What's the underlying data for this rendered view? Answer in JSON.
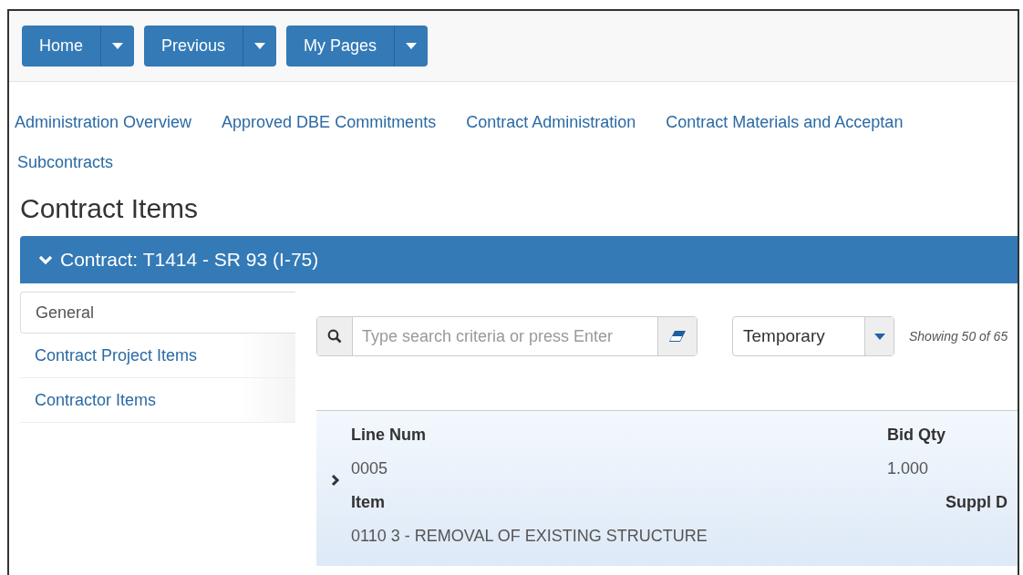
{
  "toolbar": {
    "buttons": [
      {
        "label": "Home"
      },
      {
        "label": "Previous"
      },
      {
        "label": "My Pages"
      }
    ]
  },
  "nav_links": [
    {
      "label": "Administration Overview"
    },
    {
      "label": "Approved DBE Commitments"
    },
    {
      "label": "Contract Administration"
    },
    {
      "label": "Contract Materials and Acceptan"
    },
    {
      "label": "Subcontracts"
    }
  ],
  "page_title": "Contract Items",
  "contract_panel": {
    "title": "Contract: T1414 - SR 93 (I-75)",
    "expanded": true
  },
  "side_tabs": [
    {
      "label": "General",
      "selected": true
    },
    {
      "label": "Contract Project Items",
      "selected": false
    },
    {
      "label": "Contractor Items",
      "selected": false
    }
  ],
  "search": {
    "placeholder": "Type search criteria or press Enter"
  },
  "filter": {
    "value": "Temporary"
  },
  "showing": "Showing 50 of 65",
  "rows": [
    {
      "expanded": false,
      "lines": [
        [
          {
            "label": "Line Num",
            "value": "0005"
          },
          {
            "label": "Bid Qty",
            "value": "1.000"
          }
        ],
        [
          {
            "label": "Item",
            "value": "0110 3 - REMOVAL OF EXISTING STRUCTURE"
          },
          {
            "label": "Suppl D"
          }
        ]
      ]
    }
  ]
}
